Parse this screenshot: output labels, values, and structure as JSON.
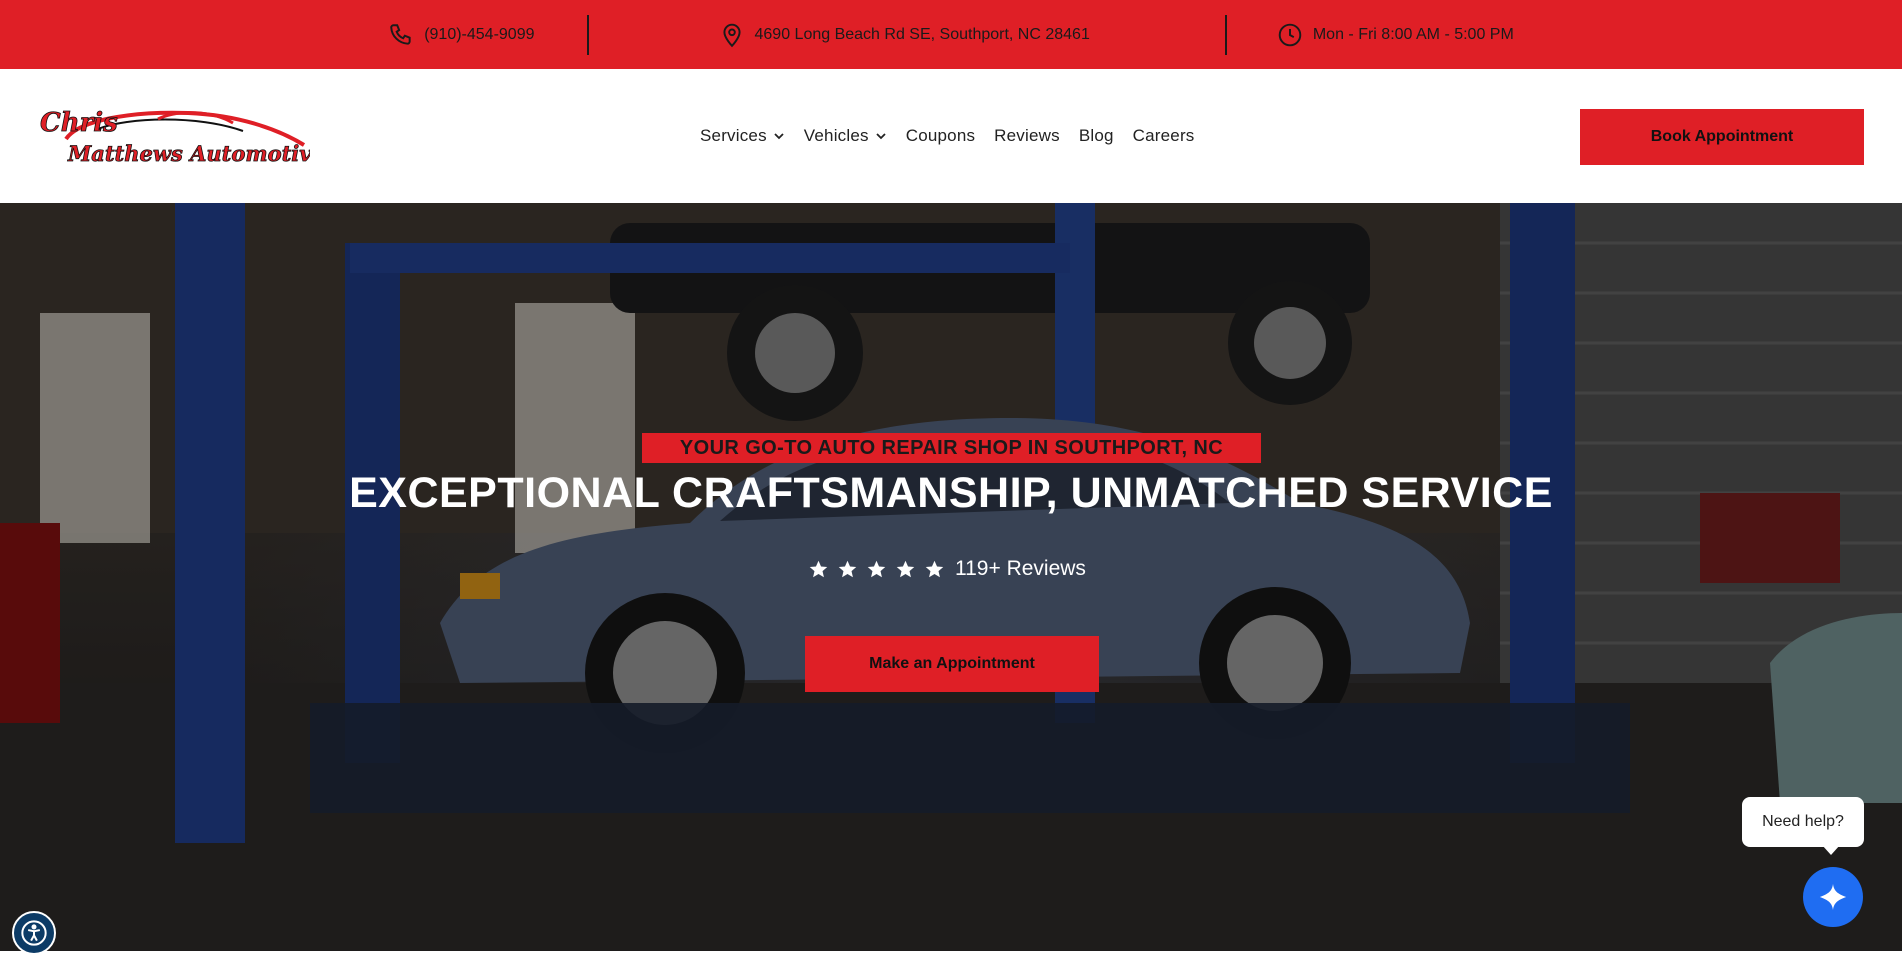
{
  "topbar": {
    "phone": "(910)-454-9099",
    "address": "4690 Long Beach Rd SE, Southport, NC 28461",
    "hours": "Mon - Fri 8:00 AM - 5:00 PM",
    "phone_icon": "phone-icon",
    "address_icon": "map-pin-icon",
    "hours_icon": "clock-icon"
  },
  "header": {
    "logo_line1": "Chris",
    "logo_line2": "Matthews Automotive",
    "nav": [
      {
        "label": "Services",
        "dropdown": true
      },
      {
        "label": "Vehicles",
        "dropdown": true
      },
      {
        "label": "Coupons",
        "dropdown": false
      },
      {
        "label": "Reviews",
        "dropdown": false
      },
      {
        "label": "Blog",
        "dropdown": false
      },
      {
        "label": "Careers",
        "dropdown": false
      }
    ],
    "book_label": "Book Appointment"
  },
  "hero": {
    "tagline": "YOUR GO-TO AUTO REPAIR SHOP IN SOUTHPORT, NC",
    "headline": "EXCEPTIONAL CRAFTSMANSHIP, UNMATCHED SERVICE",
    "stars": 5,
    "reviews_label": "119+ Reviews",
    "cta_label": "Make an Appointment"
  },
  "chat": {
    "bubble_text": "Need help?",
    "button_icon": "sparkle-icon"
  },
  "accessibility": {
    "icon": "accessibility-icon"
  },
  "colors": {
    "brand_red": "#df1f26",
    "chat_blue": "#1f6df2",
    "accessibility_blue": "#0c3b66"
  }
}
